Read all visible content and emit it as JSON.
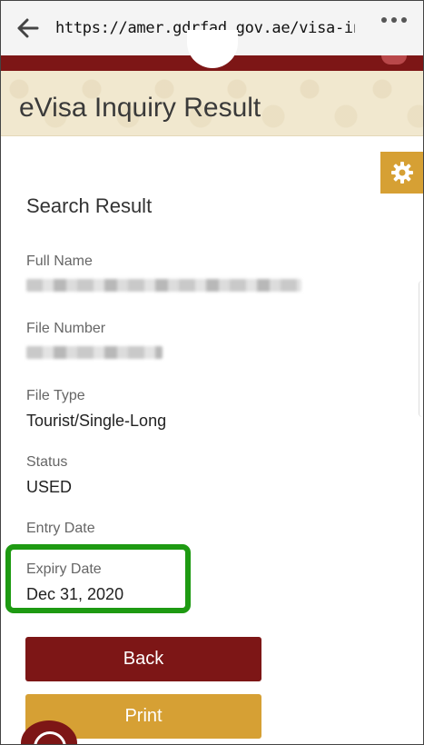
{
  "browser": {
    "url": "https://amer.gdrfad.gov.ae/visa-inquir..."
  },
  "page": {
    "title": "eVisa Inquiry Result",
    "section_title": "Search Result"
  },
  "fields": [
    {
      "label": "Full Name",
      "value": ""
    },
    {
      "label": "File Number",
      "value": ""
    },
    {
      "label": "File Type",
      "value": "Tourist/Single-Long"
    },
    {
      "label": "Status",
      "value": "USED"
    },
    {
      "label": "Entry Date",
      "value": ""
    },
    {
      "label": "Expiry Date",
      "value": "Dec 31, 2020"
    }
  ],
  "buttons": {
    "back": "Back",
    "print": "Print"
  },
  "colors": {
    "maroon": "#7d1616",
    "gold": "#d6a034",
    "highlight": "#1e9a12"
  },
  "icons": {
    "back": "arrow-left-icon",
    "menu": "more-dots-icon",
    "settings": "gear-icon"
  }
}
